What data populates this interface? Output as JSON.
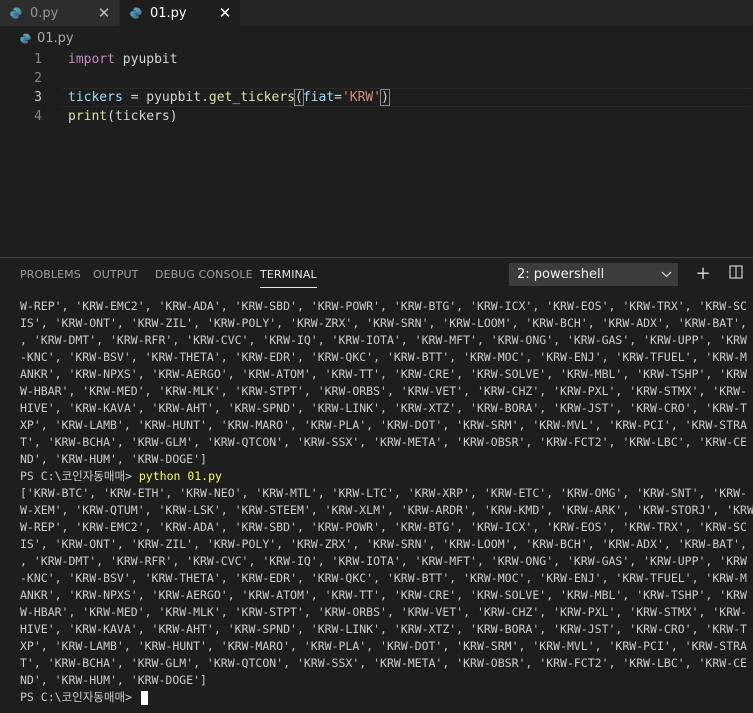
{
  "tabs": [
    {
      "label": "0.py",
      "active": false
    },
    {
      "label": "01.py",
      "active": true
    }
  ],
  "close_glyph": "✕",
  "breadcrumb": {
    "file": "01.py"
  },
  "editor": {
    "lines": [
      {
        "n": "1"
      },
      {
        "n": "2"
      },
      {
        "n": "3"
      },
      {
        "n": "4"
      }
    ],
    "code": {
      "import_kw": "import",
      "import_mod": " pyupbit",
      "l3_var": "tickers",
      "l3_eq": " = pyupbit.",
      "l3_fn": "get_tickers",
      "l3_open": "(",
      "l3_param": "fiat",
      "l3_assign": "=",
      "l3_str": "'KRW'",
      "l3_close": ")",
      "l4_fn": "print",
      "l4_rest": "(tickers)"
    }
  },
  "panel": {
    "tabs": [
      "PROBLEMS",
      "OUTPUT",
      "DEBUG CONSOLE",
      "TERMINAL"
    ],
    "active_tab": "TERMINAL",
    "shell_select": "2: powershell",
    "add_glyph": "+",
    "split_glyph": "◫"
  },
  "terminal": {
    "block1": [
      "W-REP', 'KRW-EMC2', 'KRW-ADA', 'KRW-SBD', 'KRW-POWR', 'KRW-BTG', 'KRW-ICX', 'KRW-EOS', 'KRW-TRX', 'KRW-SC",
      "IS', 'KRW-ONT', 'KRW-ZIL', 'KRW-POLY', 'KRW-ZRX', 'KRW-SRN', 'KRW-LOOM', 'KRW-BCH', 'KRW-ADX', 'KRW-BAT',",
      ", 'KRW-DMT', 'KRW-RFR', 'KRW-CVC', 'KRW-IQ', 'KRW-IOTA', 'KRW-MFT', 'KRW-ONG', 'KRW-GAS', 'KRW-UPP', 'KRW",
      "-KNC', 'KRW-BSV', 'KRW-THETA', 'KRW-EDR', 'KRW-QKC', 'KRW-BTT', 'KRW-MOC', 'KRW-ENJ', 'KRW-TFUEL', 'KRW-M",
      "ANKR', 'KRW-NPXS', 'KRW-AERGO', 'KRW-ATOM', 'KRW-TT', 'KRW-CRE', 'KRW-SOLVE', 'KRW-MBL', 'KRW-TSHP', 'KRW",
      "W-HBAR', 'KRW-MED', 'KRW-MLK', 'KRW-STPT', 'KRW-ORBS', 'KRW-VET', 'KRW-CHZ', 'KRW-PXL', 'KRW-STMX', 'KRW-",
      "HIVE', 'KRW-KAVA', 'KRW-AHT', 'KRW-SPND', 'KRW-LINK', 'KRW-XTZ', 'KRW-BORA', 'KRW-JST', 'KRW-CRO', 'KRW-T",
      "XP', 'KRW-LAMB', 'KRW-HUNT', 'KRW-MARO', 'KRW-PLA', 'KRW-DOT', 'KRW-SRM', 'KRW-MVL', 'KRW-PCI', 'KRW-STRA",
      "T', 'KRW-BCHA', 'KRW-GLM', 'KRW-QTCON', 'KRW-SSX', 'KRW-META', 'KRW-OBSR', 'KRW-FCT2', 'KRW-LBC', 'KRW-CE",
      "ND', 'KRW-HUM', 'KRW-DOGE']"
    ],
    "prompt1": "PS C:\\코인자동매매> ",
    "command1": "python 01.py",
    "block2": [
      "['KRW-BTC', 'KRW-ETH', 'KRW-NEO', 'KRW-MTL', 'KRW-LTC', 'KRW-XRP', 'KRW-ETC', 'KRW-OMG', 'KRW-SNT', 'KRW-",
      "W-XEM', 'KRW-QTUM', 'KRW-LSK', 'KRW-STEEM', 'KRW-XLM', 'KRW-ARDR', 'KRW-KMD', 'KRW-ARK', 'KRW-STORJ', 'KRW",
      "W-REP', 'KRW-EMC2', 'KRW-ADA', 'KRW-SBD', 'KRW-POWR', 'KRW-BTG', 'KRW-ICX', 'KRW-EOS', 'KRW-TRX', 'KRW-SC",
      "IS', 'KRW-ONT', 'KRW-ZIL', 'KRW-POLY', 'KRW-ZRX', 'KRW-SRN', 'KRW-LOOM', 'KRW-BCH', 'KRW-ADX', 'KRW-BAT',",
      ", 'KRW-DMT', 'KRW-RFR', 'KRW-CVC', 'KRW-IQ', 'KRW-IOTA', 'KRW-MFT', 'KRW-ONG', 'KRW-GAS', 'KRW-UPP', 'KRW",
      "-KNC', 'KRW-BSV', 'KRW-THETA', 'KRW-EDR', 'KRW-QKC', 'KRW-BTT', 'KRW-MOC', 'KRW-ENJ', 'KRW-TFUEL', 'KRW-M",
      "ANKR', 'KRW-NPXS', 'KRW-AERGO', 'KRW-ATOM', 'KRW-TT', 'KRW-CRE', 'KRW-SOLVE', 'KRW-MBL', 'KRW-TSHP', 'KRW",
      "W-HBAR', 'KRW-MED', 'KRW-MLK', 'KRW-STPT', 'KRW-ORBS', 'KRW-VET', 'KRW-CHZ', 'KRW-PXL', 'KRW-STMX', 'KRW-",
      "HIVE', 'KRW-KAVA', 'KRW-AHT', 'KRW-SPND', 'KRW-LINK', 'KRW-XTZ', 'KRW-BORA', 'KRW-JST', 'KRW-CRO', 'KRW-T",
      "XP', 'KRW-LAMB', 'KRW-HUNT', 'KRW-MARO', 'KRW-PLA', 'KRW-DOT', 'KRW-SRM', 'KRW-MVL', 'KRW-PCI', 'KRW-STRA",
      "T', 'KRW-BCHA', 'KRW-GLM', 'KRW-QTCON', 'KRW-SSX', 'KRW-META', 'KRW-OBSR', 'KRW-FCT2', 'KRW-LBC', 'KRW-CE",
      "ND', 'KRW-HUM', 'KRW-DOGE']"
    ],
    "prompt2": "PS C:\\코인자동매매> "
  },
  "colors": {
    "python_icon": "#519aba",
    "keyword": "#c586c0",
    "string": "#ce9178",
    "command": "#ffff55"
  },
  "icons": {
    "file": "python-file-icon",
    "close": "close-icon",
    "chevron": "chevron-down-icon",
    "add": "add-terminal-icon",
    "split": "split-terminal-icon"
  }
}
